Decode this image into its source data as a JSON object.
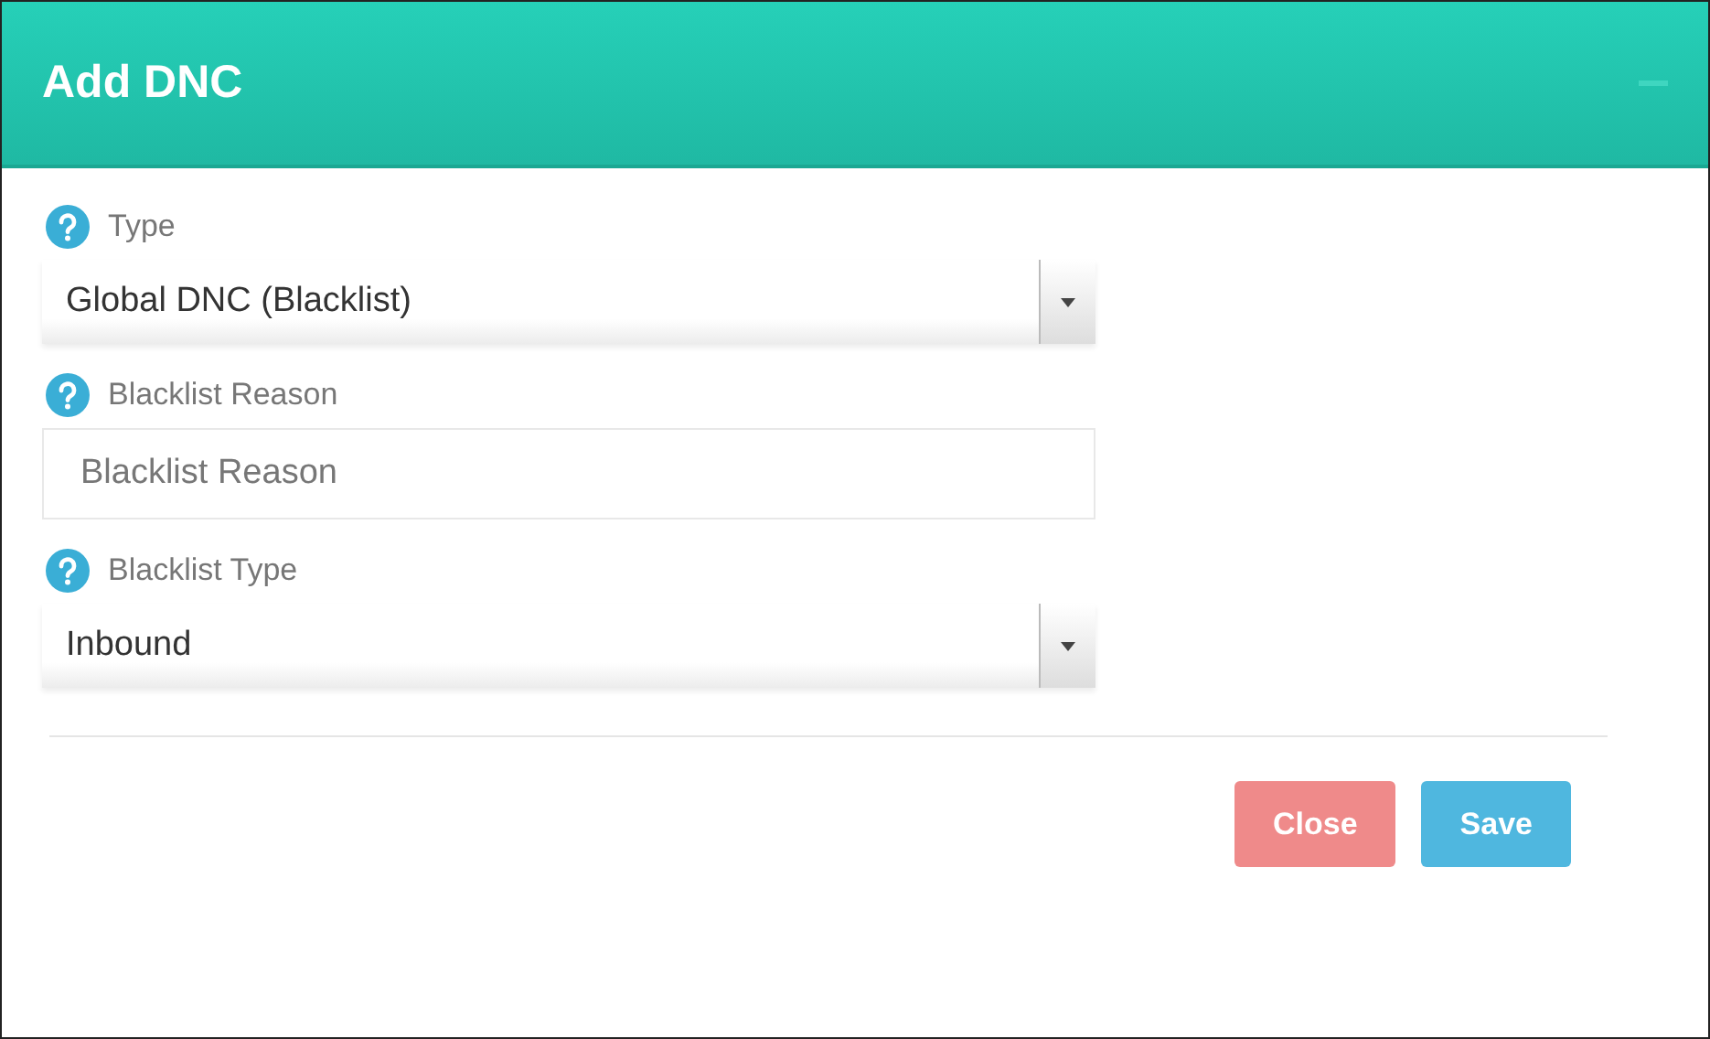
{
  "dialog": {
    "title": "Add DNC"
  },
  "fields": [
    {
      "kind": "select",
      "label": "Type",
      "value": "Global DNC (Blacklist)"
    },
    {
      "kind": "input",
      "label": "Blacklist Reason",
      "placeholder": "Blacklist Reason"
    },
    {
      "kind": "select",
      "label": "Blacklist Type",
      "value": "Inbound"
    }
  ],
  "buttons": [
    {
      "kind": "danger",
      "label": "Close"
    },
    {
      "kind": "primary",
      "label": "Save"
    }
  ]
}
